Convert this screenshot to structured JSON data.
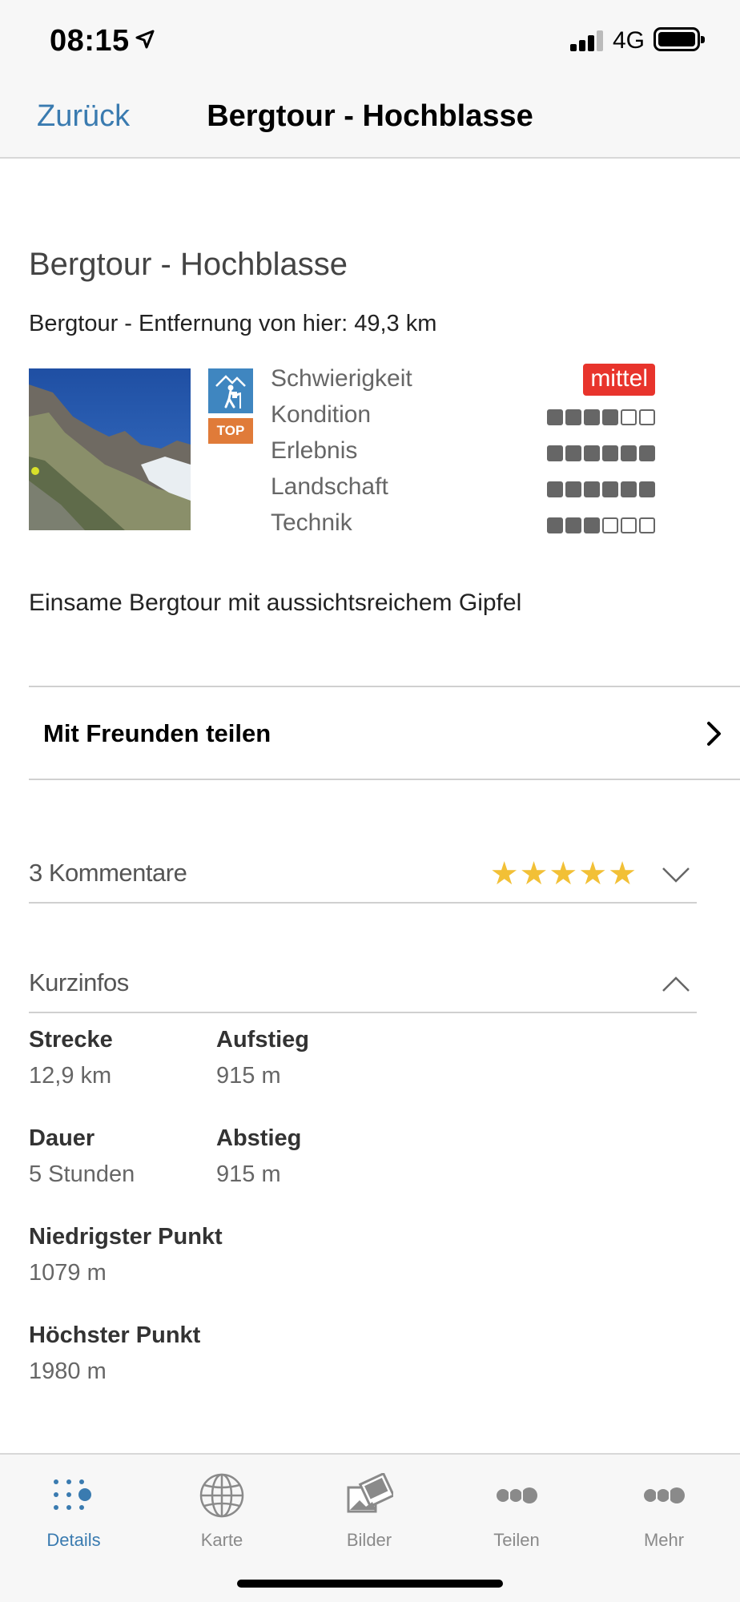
{
  "status_bar": {
    "time": "08:15",
    "network": "4G"
  },
  "nav": {
    "back_label": "Zurück",
    "title": "Bergtour - Hochblasse"
  },
  "tour": {
    "title": "Bergtour - Hochblasse",
    "subtitle": "Bergtour - Entfernung von hier: 49,3 km",
    "top_badge": "TOP",
    "difficulty_label": "Schwierigkeit",
    "difficulty_value": "mittel",
    "difficulty_color": "#e8342c",
    "ratings": [
      {
        "label": "Kondition",
        "filled": 4,
        "total": 6
      },
      {
        "label": "Erlebnis",
        "filled": 6,
        "total": 6
      },
      {
        "label": "Landschaft",
        "filled": 6,
        "total": 6
      },
      {
        "label": "Technik",
        "filled": 3,
        "total": 6
      }
    ],
    "description": "Einsame Bergtour mit aussichtsreichem Gipfel"
  },
  "share": {
    "label": "Mit Freunden teilen"
  },
  "comments": {
    "label": "3 Kommentare",
    "stars": "★★★★★",
    "rating": 5
  },
  "kurzinfos": {
    "title": "Kurzinfos",
    "items": [
      {
        "label": "Strecke",
        "value": "12,9 km"
      },
      {
        "label": "Aufstieg",
        "value": "915 m"
      },
      {
        "label": "Dauer",
        "value": "5 Stunden"
      },
      {
        "label": "Abstieg",
        "value": "915 m"
      },
      {
        "label": "Niedrigster Punkt",
        "value": "1079 m"
      },
      {
        "label": "Höchster Punkt",
        "value": "1980 m"
      }
    ]
  },
  "tabs": [
    {
      "label": "Details",
      "icon": "dots-grid-icon",
      "active": true
    },
    {
      "label": "Karte",
      "icon": "globe-icon",
      "active": false
    },
    {
      "label": "Bilder",
      "icon": "photos-icon",
      "active": false
    },
    {
      "label": "Teilen",
      "icon": "share-dots-icon",
      "active": false
    },
    {
      "label": "Mehr",
      "icon": "more-dots-icon",
      "active": false
    }
  ],
  "colors": {
    "accent": "#3a7bb0",
    "star": "#f2c036",
    "top_badge": "#e07b39",
    "hiker_badge": "#3f86c0"
  }
}
